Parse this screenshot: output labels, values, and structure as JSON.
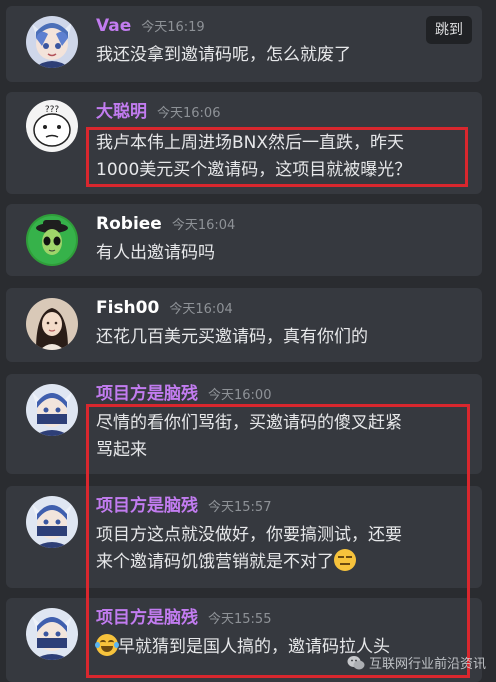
{
  "jump_label": "跳到",
  "messages": [
    {
      "author": "Vae",
      "time": "今天16:19",
      "lines": [
        "我还没拿到邀请码呢，怎么就废了"
      ],
      "avatar": "anime-avatar"
    },
    {
      "author": "大聪明",
      "time": "今天16:06",
      "lines": [
        "我卢本伟上周进场BNX然后一直跌，昨天",
        "1000美元买个邀请码，这项目就被曝光？"
      ],
      "avatar": "meme-avatar"
    },
    {
      "author": "Robiee",
      "time": "今天16:04",
      "lines": [
        "有人出邀请码吗"
      ],
      "avatar": "alien-avatar"
    },
    {
      "author": "Fish00",
      "time": "今天16:04",
      "lines": [
        "还花几百美元买邀请码，真有你们的"
      ],
      "avatar": "girl-avatar"
    },
    {
      "author": "项目方是脑残",
      "time": "今天16:00",
      "lines": [
        "尽情的看你们骂街，买邀请码的傻叉赶紧",
        "骂起来"
      ],
      "avatar": "ninja-avatar"
    },
    {
      "author": "项目方是脑残",
      "time": "今天15:57",
      "lines": [
        "项目方这点就没做好，你要搞测试，还要",
        "来个邀请码饥饿营销就是不对了"
      ],
      "avatar": "ninja-avatar"
    },
    {
      "author": "项目方是脑残",
      "time": "今天15:55",
      "lines": [
        "早就猜到是国人搞的，邀请码拉人头"
      ],
      "avatar": "ninja-avatar"
    }
  ],
  "meme_avatar_text": "???",
  "watermark": "互联网行业前沿资讯",
  "colors": {
    "background": "#2a2c30",
    "card": "#36393f",
    "purple_name": "#c27cf0",
    "highlight_box": "#d9272e"
  }
}
